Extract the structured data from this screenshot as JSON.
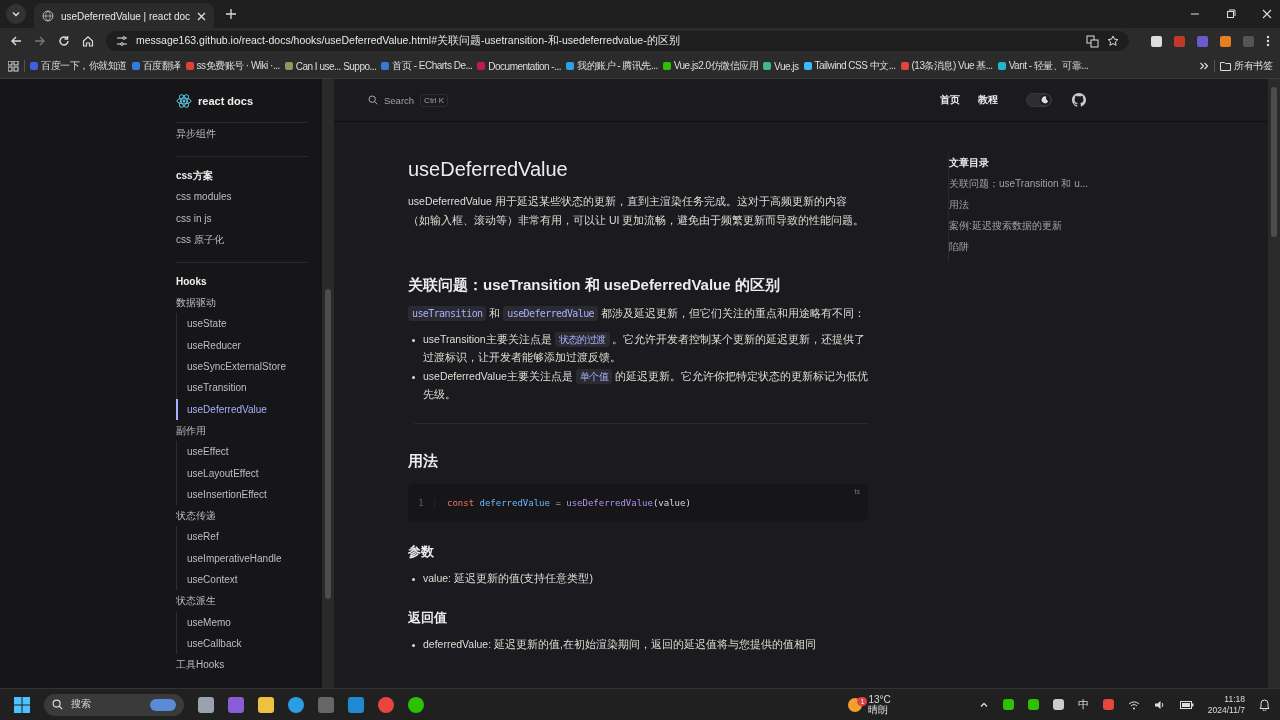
{
  "browser": {
    "tabs": [
      {
        "title": "useDeferredValue | react doc",
        "selected": true
      }
    ],
    "url": "message163.github.io/react-docs/hooks/useDeferredValue.html#关联问题-usetransition-和-usedeferredvalue-的区别",
    "bookmarks": [
      {
        "label": "百度一下，你就知道",
        "color": "#3b5fe0"
      },
      {
        "label": "百度翻译",
        "color": "#2f7de1"
      },
      {
        "label": "ss免费账号 · Wiki ·...",
        "color": "#e2432a"
      },
      {
        "label": "Can I use... Suppo...",
        "color": "#8a9a5b"
      },
      {
        "label": "首页 - ECharts De...",
        "color": "#3a78d8"
      },
      {
        "label": "Documentation -...",
        "color": "#c2185b"
      },
      {
        "label": "我的账户 - 腾讯先...",
        "color": "#2aa3e6"
      },
      {
        "label": "Vue.js2.0仿微信应用",
        "color": "#2dc100"
      },
      {
        "label": "Vue.js",
        "color": "#41b883"
      },
      {
        "label": "Tailwind CSS 中文...",
        "color": "#38bdf8"
      },
      {
        "label": "(13条消息) Vue 基...",
        "color": "#e0473b"
      },
      {
        "label": "Vant - 轻量、可靠...",
        "color": "#1fb8c9"
      }
    ],
    "all_bookmarks": "所有书签"
  },
  "site": {
    "logo": "react docs",
    "search": {
      "placeholder": "Search",
      "shortcut": "Ctrl K"
    },
    "nav": [
      "首页",
      "教程"
    ],
    "appearance_switch": {
      "on": true
    }
  },
  "sidebar": {
    "sections": [
      {
        "items": [
          {
            "label": "异步组件",
            "selected": false
          }
        ]
      },
      {
        "title": "css方案",
        "items": [
          {
            "label": "css modules",
            "selected": false
          },
          {
            "label": "css in js",
            "selected": false
          },
          {
            "label": "css 原子化",
            "selected": false
          }
        ]
      },
      {
        "title": "Hooks",
        "items": [
          {
            "label": "数据驱动",
            "selected": false,
            "children": [
              {
                "label": "useState",
                "selected": false
              },
              {
                "label": "useReducer",
                "selected": false
              },
              {
                "label": "useSyncExternalStore",
                "selected": false
              },
              {
                "label": "useTransition",
                "selected": false
              },
              {
                "label": "useDeferredValue",
                "selected": true
              }
            ]
          },
          {
            "label": "副作用",
            "selected": false,
            "children": [
              {
                "label": "useEffect",
                "selected": false
              },
              {
                "label": "useLayoutEffect",
                "selected": false
              },
              {
                "label": "useInsertionEffect",
                "selected": false
              }
            ]
          },
          {
            "label": "状态传递",
            "selected": false,
            "children": [
              {
                "label": "useRef",
                "selected": false
              },
              {
                "label": "useImperativeHandle",
                "selected": false
              },
              {
                "label": "useContext",
                "selected": false
              }
            ]
          },
          {
            "label": "状态派生",
            "selected": false,
            "children": [
              {
                "label": "useMemo",
                "selected": false
              },
              {
                "label": "useCallback",
                "selected": false
              }
            ]
          },
          {
            "label": "工具Hooks",
            "selected": false
          }
        ]
      }
    ]
  },
  "article": {
    "title": "useDeferredValue",
    "intro": "useDeferredValue 用于延迟某些状态的更新，直到主渲染任务完成。这对于高频更新的内容（如输入框、滚动等）非常有用，可以让 UI 更加流畅，避免由于频繁更新而导致的性能问题。",
    "blocks": [
      {
        "kind": "h2",
        "text": "关联问题：useTransition 和 useDeferredValue 的区别"
      },
      {
        "kind": "paragraph",
        "segments": [
          {
            "kind": "code",
            "text": "useTransition"
          },
          {
            "kind": "text",
            "text": " 和 "
          },
          {
            "kind": "code",
            "text": "useDeferredValue"
          },
          {
            "kind": "text",
            "text": " 都涉及延迟更新，但它们关注的重点和用途略有不同："
          }
        ]
      },
      {
        "kind": "list",
        "items": [
          [
            {
              "kind": "text",
              "text": "useTransition主要关注点是 "
            },
            {
              "kind": "code",
              "text": "状态的过渡"
            },
            {
              "kind": "text",
              "text": " 。它允许开发者控制某个更新的延迟更新，还提供了过渡标识，让开发者能够添加过渡反馈。"
            }
          ],
          [
            {
              "kind": "text",
              "text": "useDeferredValue主要关注点是 "
            },
            {
              "kind": "code",
              "text": "单个值"
            },
            {
              "kind": "text",
              "text": " 的延迟更新。它允许你把特定状态的更新标记为低优先级。"
            }
          ]
        ]
      },
      {
        "kind": "rule"
      },
      {
        "kind": "h2",
        "text": "用法"
      },
      {
        "kind": "code",
        "lang": "ts",
        "lines": [
          {
            "number": "1",
            "tokens": [
              {
                "kind": "keyword",
                "text": "const "
              },
              {
                "kind": "variable",
                "text": "deferredValue "
              },
              {
                "kind": "operator",
                "text": "= "
              },
              {
                "kind": "function",
                "text": "useDeferredValue"
              },
              {
                "kind": "plain",
                "text": "(value)"
              }
            ]
          }
        ]
      },
      {
        "kind": "h3",
        "text": "参数"
      },
      {
        "kind": "list",
        "items": [
          [
            {
              "kind": "text",
              "text": "value: 延迟更新的值(支持任意类型)"
            }
          ]
        ]
      },
      {
        "kind": "h3",
        "text": "返回值"
      },
      {
        "kind": "list",
        "items": [
          [
            {
              "kind": "text",
              "text": "deferredValue: 延迟更新的值,在初始渲染期间，返回的延迟值将与您提供的值相同"
            }
          ]
        ]
      }
    ]
  },
  "toc": {
    "title": "文章目录",
    "items": [
      "关联问题：useTransition 和 u...",
      "用法",
      "案例:延迟搜索数据的更新",
      "陷阱"
    ]
  },
  "taskbar": {
    "search": "搜索",
    "weather": {
      "temp": "13°C",
      "desc": "晴朗",
      "badge": "1"
    },
    "ime": "中",
    "time": "11:18",
    "date": "2024/11/7"
  }
}
